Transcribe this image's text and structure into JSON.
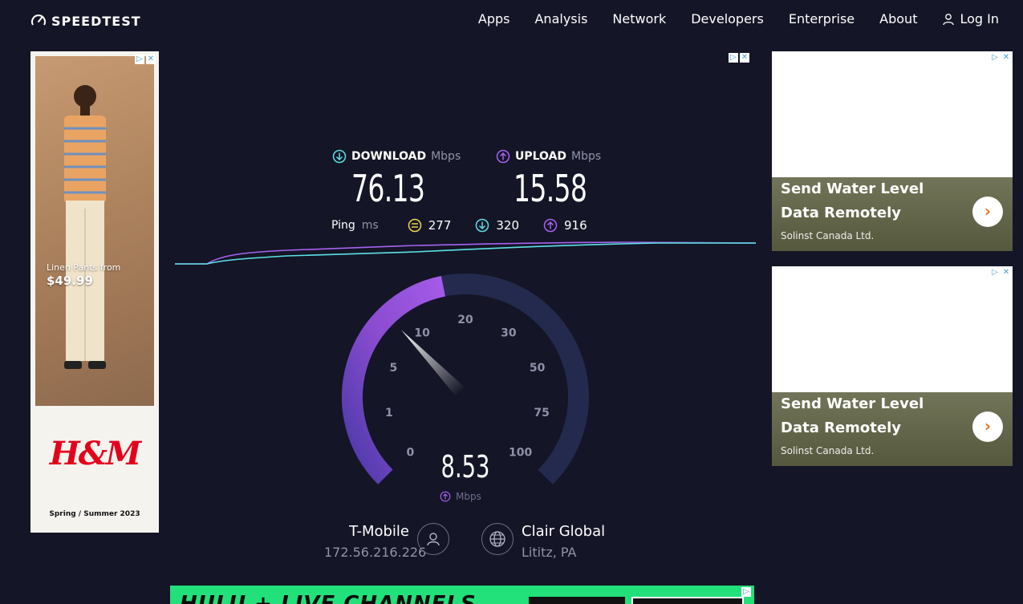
{
  "header": {
    "brand": "SPEEDTEST",
    "nav": [
      "Apps",
      "Analysis",
      "Network",
      "Developers",
      "Enterprise",
      "About"
    ],
    "login": "Log In"
  },
  "ads": {
    "left": {
      "promo_line1": "Linen Pants from",
      "promo_price": "$49.99",
      "brand": "H&M",
      "season": "Spring / Summer 2023"
    },
    "right": [
      {
        "title": "Send Water Level Data Remotely",
        "advertiser": "Solinst Canada Ltd."
      },
      {
        "title": "Send Water Level Data Remotely",
        "advertiser": "Solinst Canada Ltd."
      }
    ],
    "bottom": {
      "text": "HULU + LIVE CHANNELS"
    }
  },
  "results": {
    "download": {
      "label": "DOWNLOAD",
      "unit": "Mbps",
      "value": "76.13"
    },
    "upload": {
      "label": "UPLOAD",
      "unit": "Mbps",
      "value": "15.58"
    },
    "ping": {
      "label": "Ping",
      "unit": "ms",
      "idle": "277",
      "down": "320",
      "up": "916"
    }
  },
  "gauge": {
    "current_value": "8.53",
    "unit": "Mbps",
    "ticks": [
      "0",
      "1",
      "5",
      "10",
      "20",
      "30",
      "50",
      "75",
      "100"
    ],
    "current_numeric": 8.53
  },
  "provider": {
    "name": "T-Mobile",
    "ip": "172.56.216.226"
  },
  "server": {
    "name": "Clair Global",
    "location": "Lititz, PA"
  },
  "colors": {
    "download": "#5ce1e6",
    "upload": "#a663f0",
    "ping": "#f1d54f",
    "bg": "#141526",
    "track": "#242a4e"
  }
}
